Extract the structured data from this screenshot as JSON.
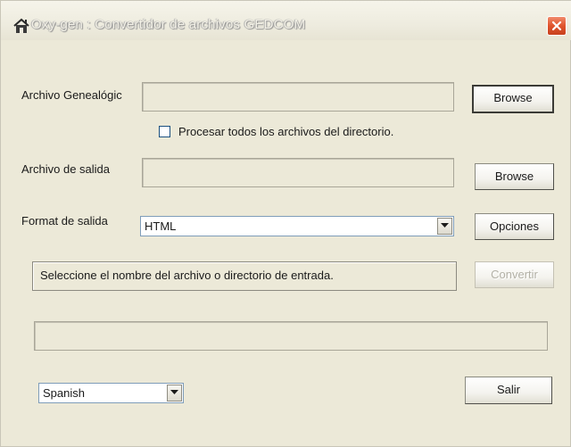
{
  "window": {
    "title": "Oxy-gen : Convertidor de archivos GEDCOM"
  },
  "form": {
    "input_label": "Archivo Genealógic",
    "input_value": "",
    "browse_input_label": "Browse",
    "process_all_label": "Procesar todos los archivos del directorio.",
    "process_all_checked": false,
    "output_label": "Archivo de salida",
    "output_value": "",
    "browse_output_label": "Browse",
    "format_label": "Format de salida",
    "format_value": "HTML",
    "options_label": "Opciones",
    "status_text": "Seleccione el nombre del archivo o directorio de entrada.",
    "convert_label": "Convertir",
    "progress_text": "",
    "language_value": "Spanish",
    "exit_label": "Salir"
  },
  "icons": {
    "app": "house-icon",
    "close": "close-icon",
    "dropdown": "chevron-down-icon"
  },
  "colors": {
    "window_bg": "#ece9d8",
    "close_button": "#e0542d"
  }
}
